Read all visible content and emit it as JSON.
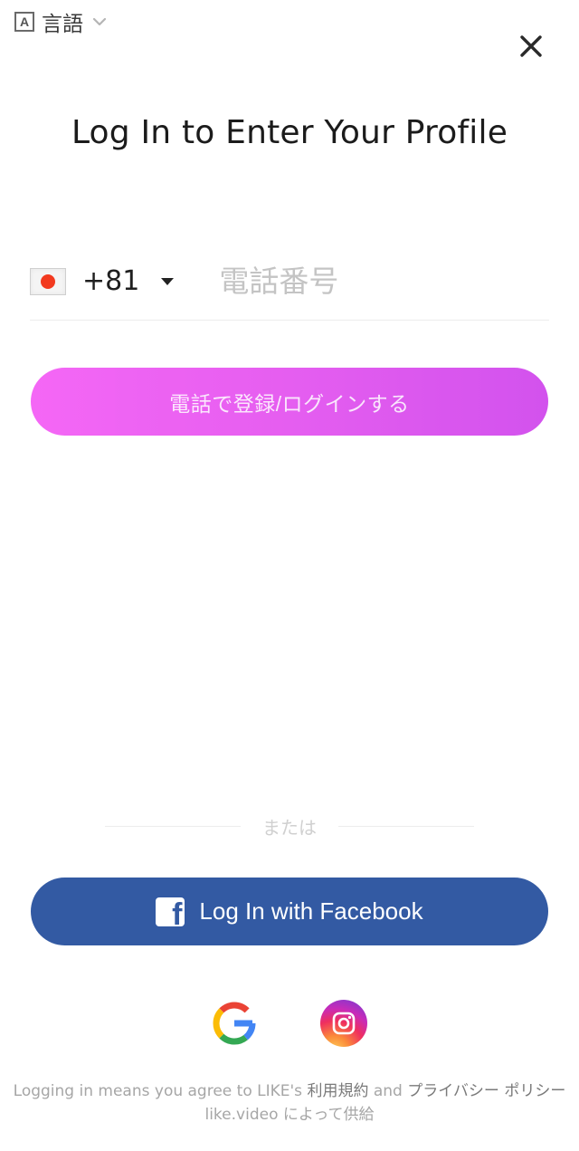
{
  "header": {
    "language_box_letter": "A",
    "language_label": "言語"
  },
  "title": "Log In to Enter Your Profile",
  "phone": {
    "country_code": "+81",
    "placeholder": "電話番号",
    "value": ""
  },
  "primary_button_label": "電話で登録/ログインする",
  "divider_label": "または",
  "facebook_button_label": "Log In with Facebook",
  "footer": {
    "prefix": "Logging in means you agree to LIKE's ",
    "terms": "利用規約",
    "and": " and ",
    "privacy": "プライバシー ポリシー",
    "line2": "like.video によって供給"
  },
  "colors": {
    "primary_gradient_start": "#f45ff5",
    "primary_gradient_end": "#d049ec",
    "facebook_blue": "#335aa3",
    "flag_red": "#f23a1f"
  },
  "icons": {
    "language": "language-icon",
    "close": "close-icon",
    "flag": "japan-flag-icon",
    "facebook": "facebook-icon",
    "google": "google-icon",
    "instagram": "instagram-icon"
  }
}
